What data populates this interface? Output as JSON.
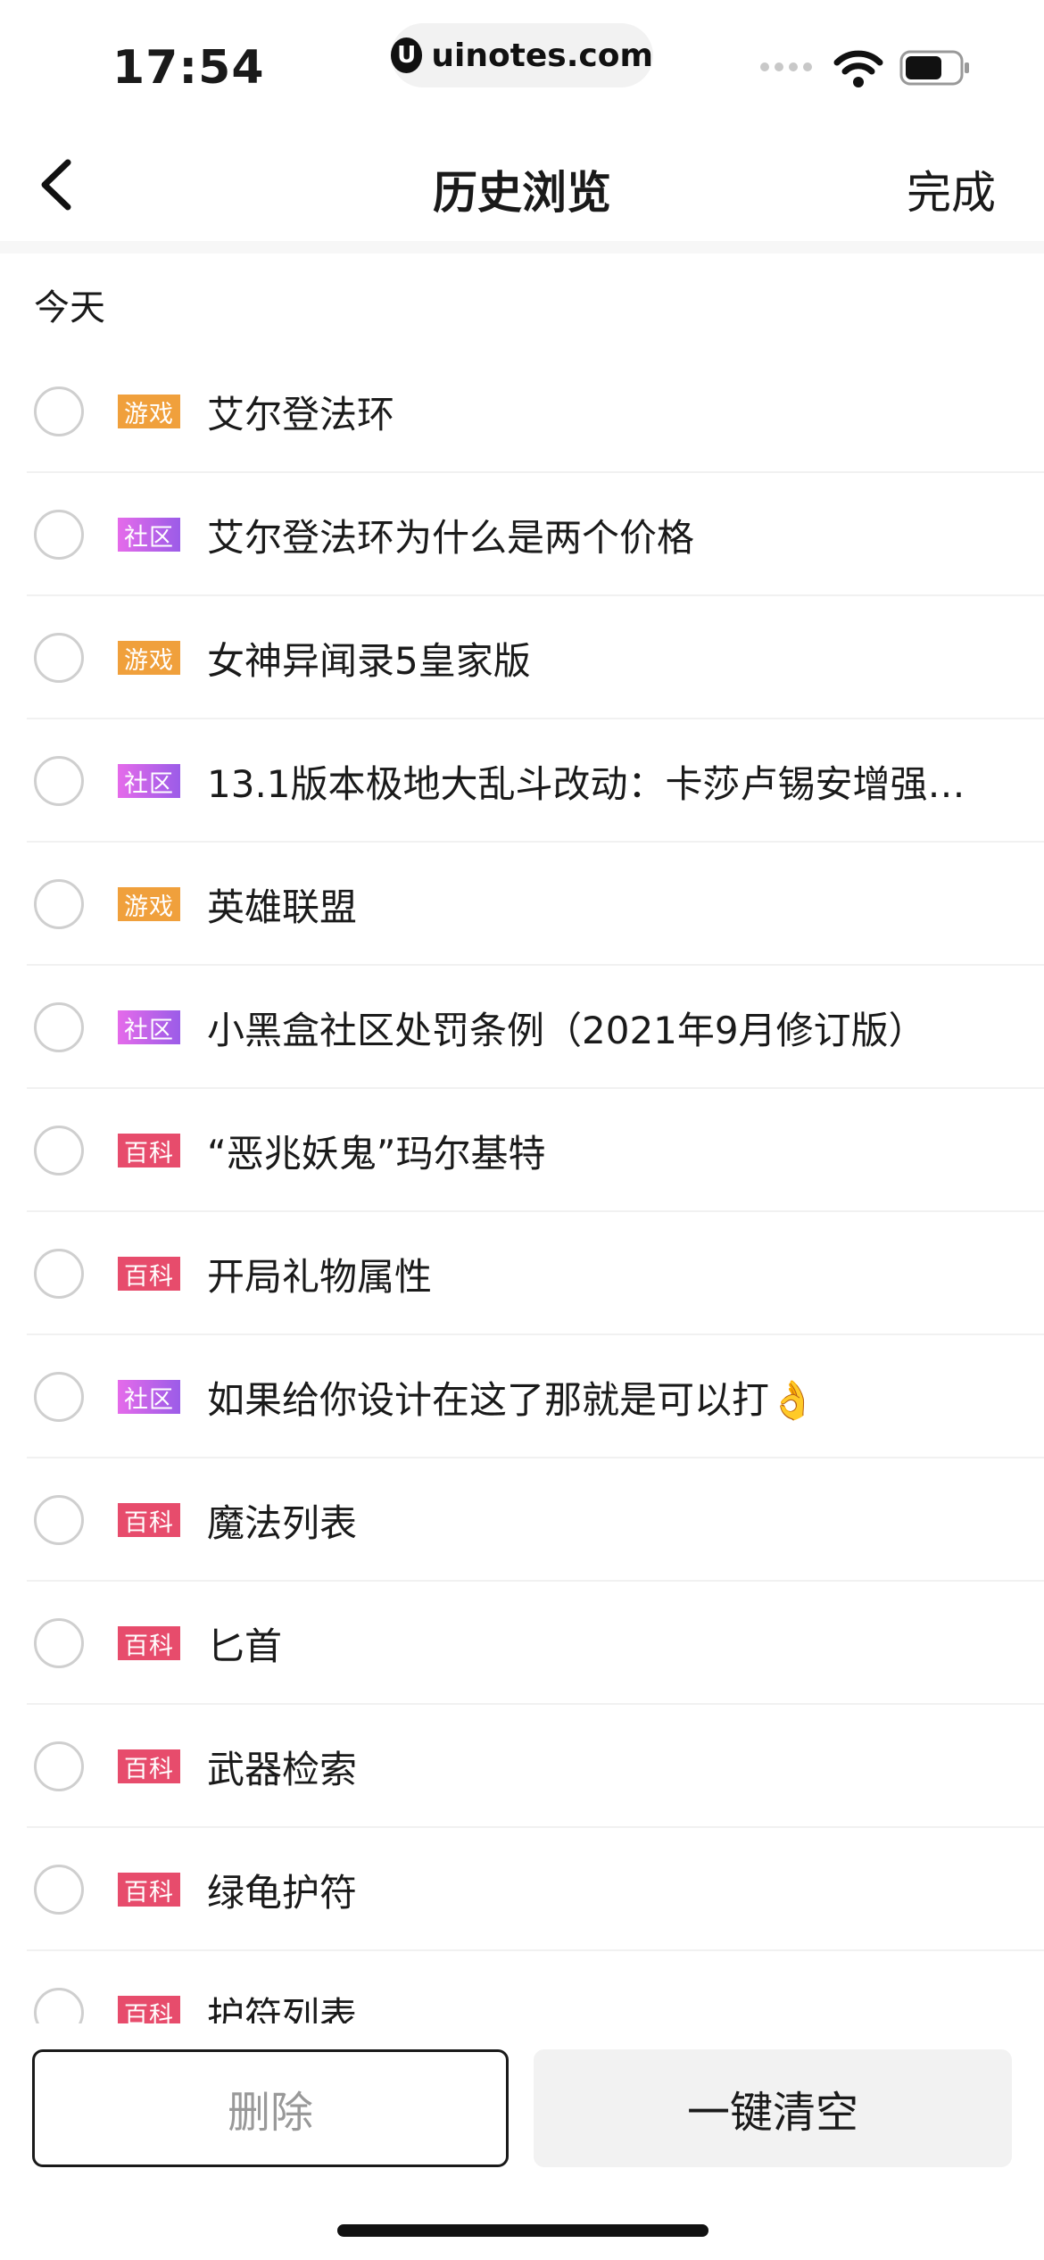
{
  "status_bar": {
    "time": "17:54",
    "url": "uinotes.com",
    "logo_letter": "U"
  },
  "nav": {
    "title": "历史浏览",
    "done_label": "完成",
    "back_icon": "chevron-left-icon"
  },
  "section": {
    "today_label": "今天"
  },
  "tag_colors": {
    "game": "#f0a03c",
    "community": "#b564e9",
    "wiki": "#e74c6c"
  },
  "items": [
    {
      "tag": "游戏",
      "type": "game",
      "title": "艾尔登法环"
    },
    {
      "tag": "社区",
      "type": "community",
      "title": "艾尔登法环为什么是两个价格"
    },
    {
      "tag": "游戏",
      "type": "game",
      "title": "女神异闻录5皇家版"
    },
    {
      "tag": "社区",
      "type": "community",
      "title": "13.1版本极地大乱斗改动：卡莎卢锡安增强；..."
    },
    {
      "tag": "游戏",
      "type": "game",
      "title": "英雄联盟"
    },
    {
      "tag": "社区",
      "type": "community",
      "title": "小黑盒社区处罚条例（2021年9月修订版）"
    },
    {
      "tag": "百科",
      "type": "wiki",
      "title": "“恶兆妖鬼”玛尔基特"
    },
    {
      "tag": "百科",
      "type": "wiki",
      "title": "开局礼物属性"
    },
    {
      "tag": "社区",
      "type": "community",
      "title": "如果给你设计在这了那就是可以打👌"
    },
    {
      "tag": "百科",
      "type": "wiki",
      "title": "魔法列表"
    },
    {
      "tag": "百科",
      "type": "wiki",
      "title": "匕首"
    },
    {
      "tag": "百科",
      "type": "wiki",
      "title": "武器检索"
    },
    {
      "tag": "百科",
      "type": "wiki",
      "title": "绿龟护符"
    },
    {
      "tag": "百科",
      "type": "wiki",
      "title": "护符列表"
    }
  ],
  "bottom": {
    "delete_label": "删除",
    "clear_all_label": "一键清空"
  }
}
